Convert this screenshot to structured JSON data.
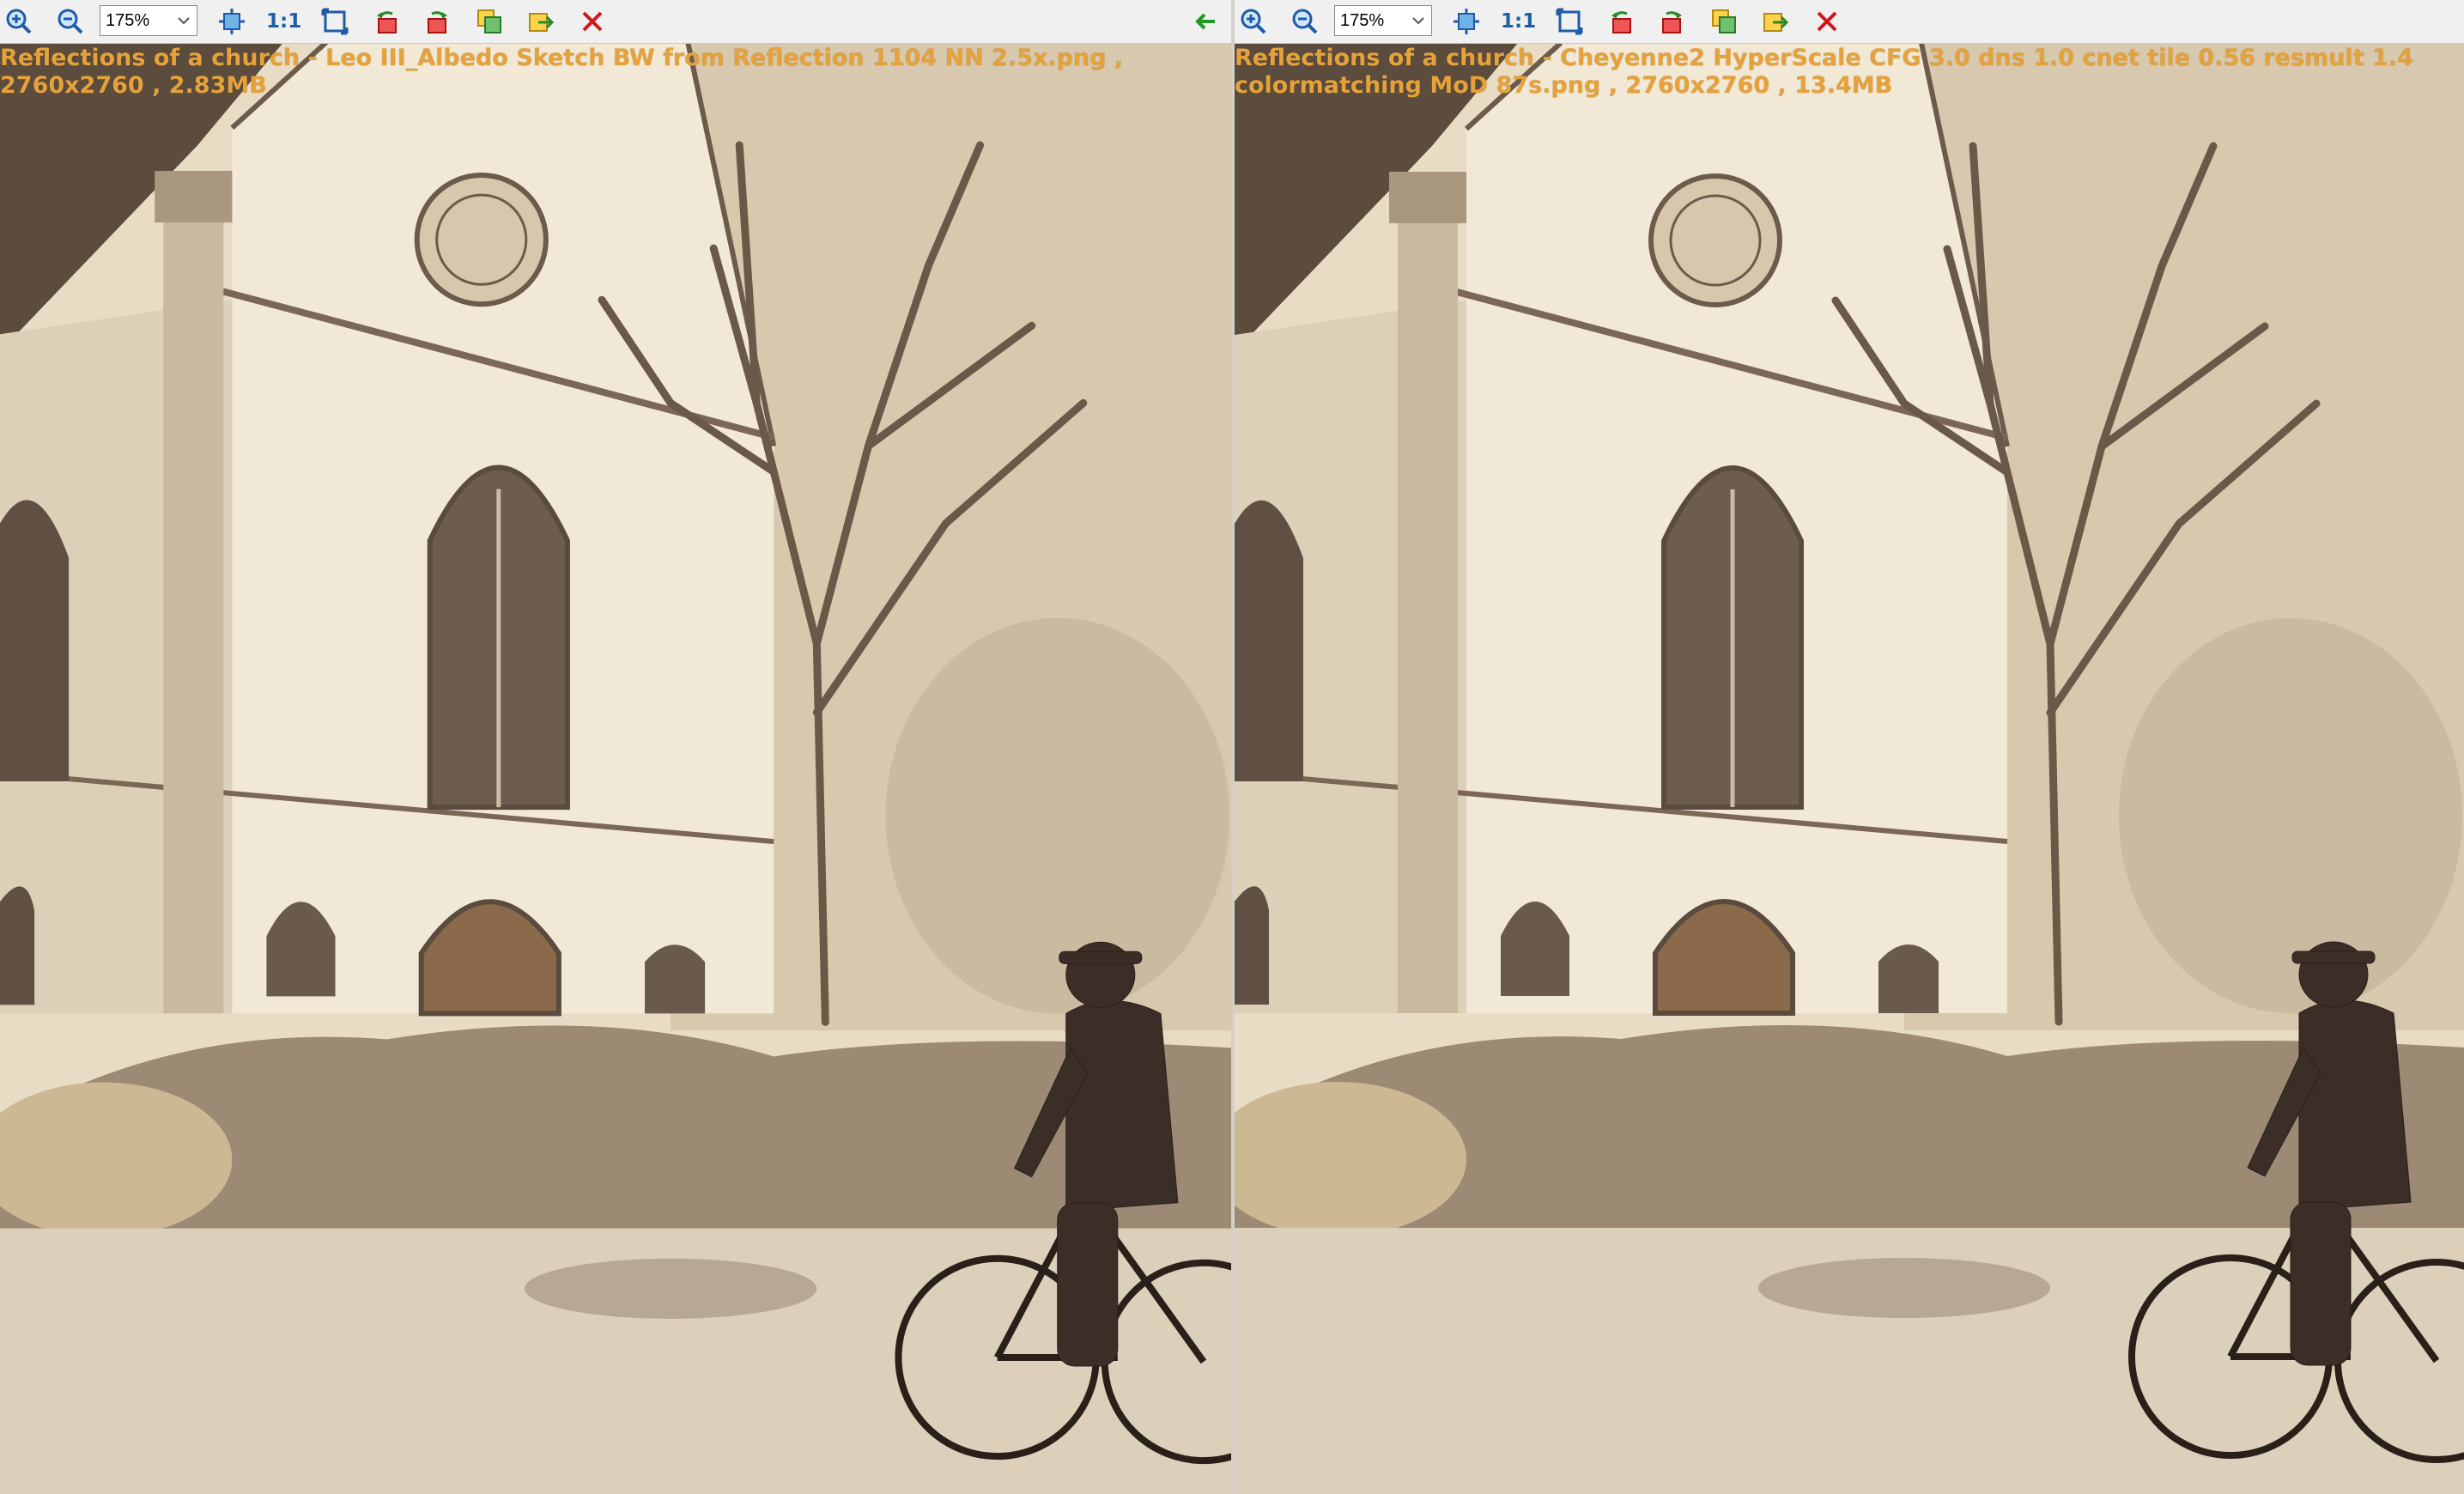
{
  "colors": {
    "caption": "#e6a23a",
    "toolbar_bg": "#f0f0f0",
    "sepia_light": "#ede3d0",
    "sepia_dark": "#3a2e26"
  },
  "left_viewer": {
    "zoom": "175%",
    "tools": [
      "zoom-in-icon",
      "zoom-out-icon",
      "fit-icon",
      "actual-size",
      "fullscreen-icon",
      "rotate-left-icon",
      "rotate-right-icon",
      "swap-icon",
      "export-icon",
      "close-icon"
    ],
    "actual_size_label": "1:1",
    "caption_line1": "Reflections of a church - Leo III_Albedo Sketch BW from Reflection 1104 NN 2.5x.png ,",
    "caption_line2": "2760x2760 , 2.83MB"
  },
  "right_viewer": {
    "zoom": "175%",
    "actual_size_label": "1:1",
    "caption_line1": "Reflections of a church - Cheyenne2 HyperScale CFG 3.0 dns 1.0 cnet tile 0.56 resmult 1.4",
    "caption_line2": "colormatching MoD 87s.png , 2760x2760 , 13.4MB"
  }
}
